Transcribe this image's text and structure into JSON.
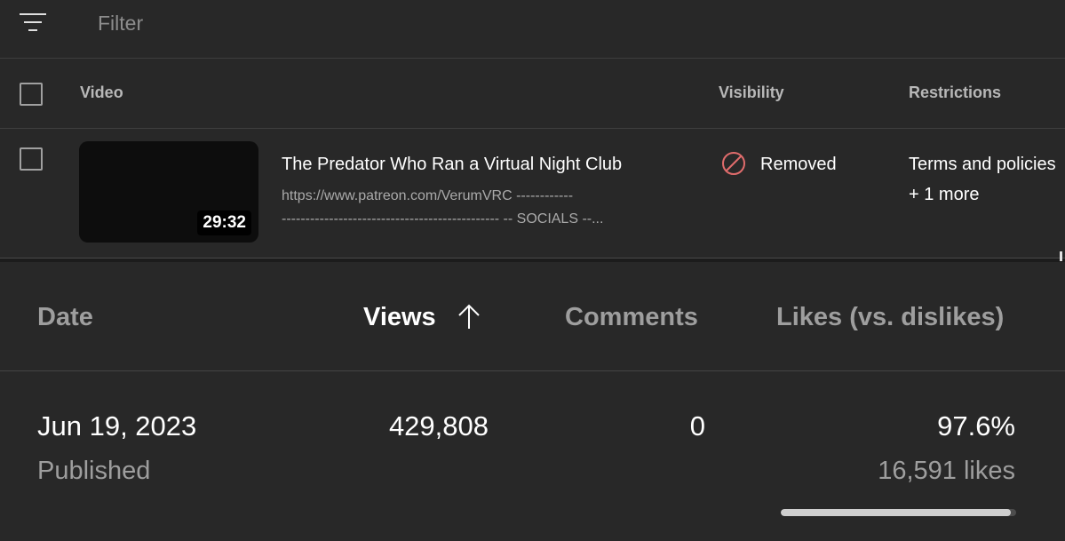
{
  "filter": {
    "placeholder": "Filter",
    "icon": "filter-sort-icon"
  },
  "table": {
    "headers": {
      "video": "Video",
      "visibility": "Visibility",
      "restrictions": "Restrictions"
    },
    "row": {
      "title": "The Predator Who Ran a Virtual Night Club",
      "duration": "29:32",
      "description_line1": "https://www.patreon.com/VerumVRC ------------",
      "description_line2": "---------------------------------------------- -- SOCIALS --...",
      "visibility": "Removed",
      "visibility_icon": "removed-block-icon",
      "visibility_color": "#e06c6c",
      "restrictions": "Terms and policies",
      "restrictions_more": "+ 1 more"
    }
  },
  "analytics": {
    "headers": {
      "date": "Date",
      "views": "Views",
      "comments": "Comments",
      "likes": "Likes (vs. dislikes)"
    },
    "sort_icon": "arrow-up-icon",
    "row": {
      "date": "Jun 19, 2023",
      "date_sub": "Published",
      "views": "429,808",
      "comments": "0",
      "likes_percent": "97.6%",
      "likes_count": "16,591 likes",
      "likes_ratio": 0.976
    }
  },
  "colors": {
    "background": "#282828",
    "muted_text": "#9e9e9e",
    "bar_fill": "#cfcfcf",
    "bar_track": "#4d4d4d"
  }
}
